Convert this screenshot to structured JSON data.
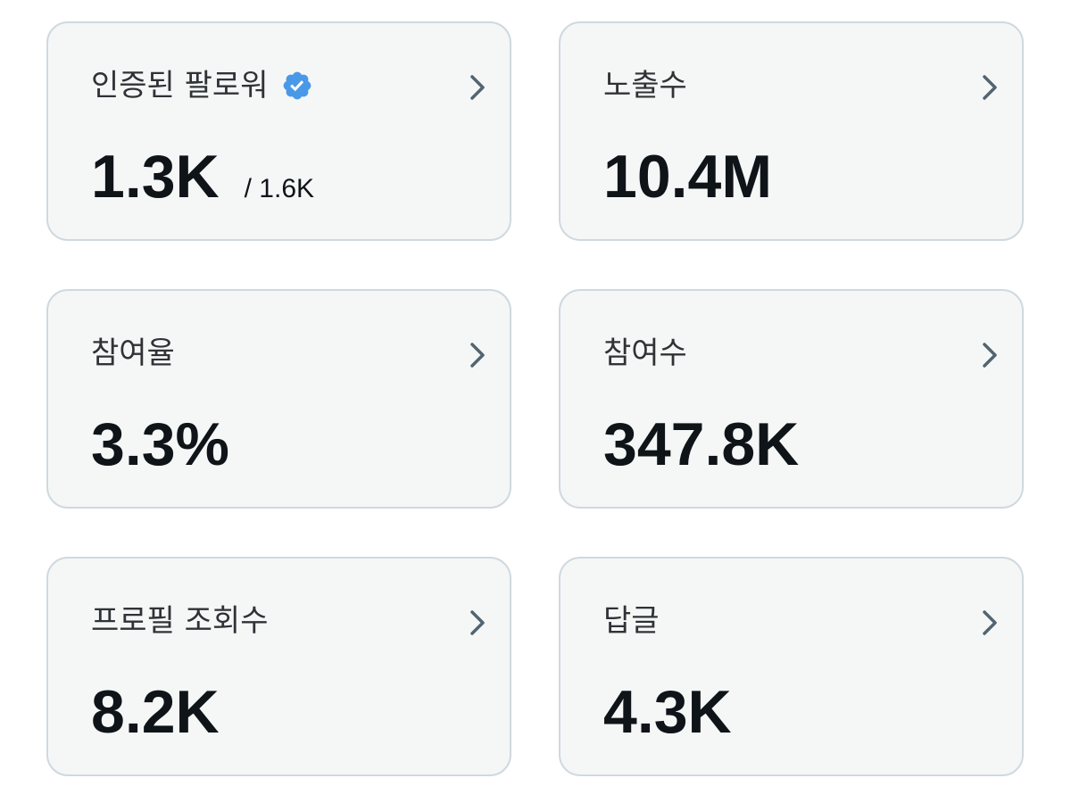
{
  "cards": [
    {
      "label": "인증된 팔로워",
      "value": "1.3K",
      "sub": "/ 1.6K",
      "verified_icon": "verified-badge-icon",
      "chevron_icon": "chevron-right-icon"
    },
    {
      "label": "노출수",
      "value": "10.4M",
      "chevron_icon": "chevron-right-icon"
    },
    {
      "label": "참여율",
      "value": "3.3%",
      "chevron_icon": "chevron-right-icon"
    },
    {
      "label": "참여수",
      "value": "347.8K",
      "chevron_icon": "chevron-right-icon"
    },
    {
      "label": "프로필 조회수",
      "value": "8.2K",
      "chevron_icon": "chevron-right-icon"
    },
    {
      "label": "답글",
      "value": "4.3K",
      "chevron_icon": "chevron-right-icon"
    }
  ],
  "colors": {
    "card_background": "#f5f7f7",
    "card_border": "#cfd9de",
    "verified_blue": "#4a99e9",
    "chevron": "#536471",
    "value_text": "#0f1419"
  }
}
